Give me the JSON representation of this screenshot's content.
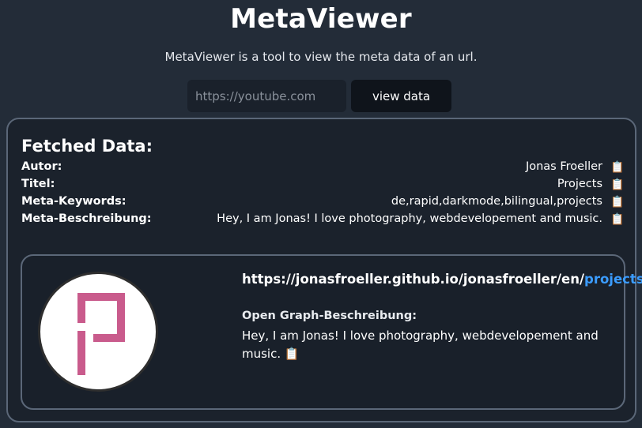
{
  "app": {
    "title": "MetaViewer",
    "subtitle": "MetaViewer is a tool to view the meta data of an url."
  },
  "search": {
    "placeholder": "https://youtube.com",
    "value": "",
    "button_label": "view data"
  },
  "result": {
    "heading": "Fetched Data:",
    "rows": [
      {
        "label": "Autor:",
        "value": "Jonas Froeller",
        "icon": "clipboard-icon"
      },
      {
        "label": "Titel:",
        "value": "Projects",
        "icon": "clipboard-icon"
      },
      {
        "label": "Meta-Keywords:",
        "value": "de,rapid,darkmode,bilingual,projects",
        "icon": "clipboard-icon"
      },
      {
        "label": "Meta-Beschreibung:",
        "value": "Hey, I am Jonas! I love photography, webdevelopement and music.",
        "icon": "clipboard-icon"
      }
    ],
    "copy_glyph": "📋"
  },
  "og_card": {
    "url_base": "https://jonasfroeller.github.io/jonasfroeller/en/",
    "url_highlight": "projects",
    "description_label": "Open Graph-Beschreibung:",
    "description": "Hey, I am Jonas! I love photography, webdevelopement and music.",
    "logo_color": "#c95b8c"
  },
  "colors": {
    "background": "#232c38",
    "panel": "#1b222c",
    "border": "#5b6778",
    "accent_link": "#3b9cff"
  }
}
